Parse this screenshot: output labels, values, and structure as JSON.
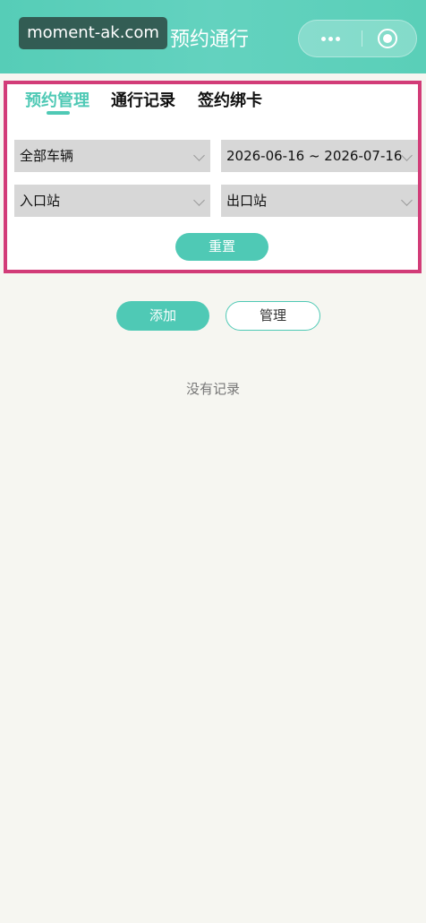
{
  "header": {
    "watermark": "moment-ak.com",
    "title": "预约通行",
    "background_color": "#5acfb8",
    "more_icon": "more-dots-icon",
    "close_icon": "target-circle-icon"
  },
  "tabs": [
    {
      "label": "预约管理",
      "active": true
    },
    {
      "label": "通行记录",
      "active": false
    },
    {
      "label": "签约绑卡",
      "active": false
    }
  ],
  "filters": {
    "vehicle": "全部车辆",
    "date_range": "2026-06-16 ~ 2026-07-16",
    "entry_station": "入口站",
    "exit_station": "出口站",
    "reset_label": "重置"
  },
  "actions": {
    "add_label": "添加",
    "manage_label": "管理"
  },
  "empty_text": "没有记录",
  "colors": {
    "accent": "#4fc9b5",
    "highlight_border": "#d23c78"
  }
}
